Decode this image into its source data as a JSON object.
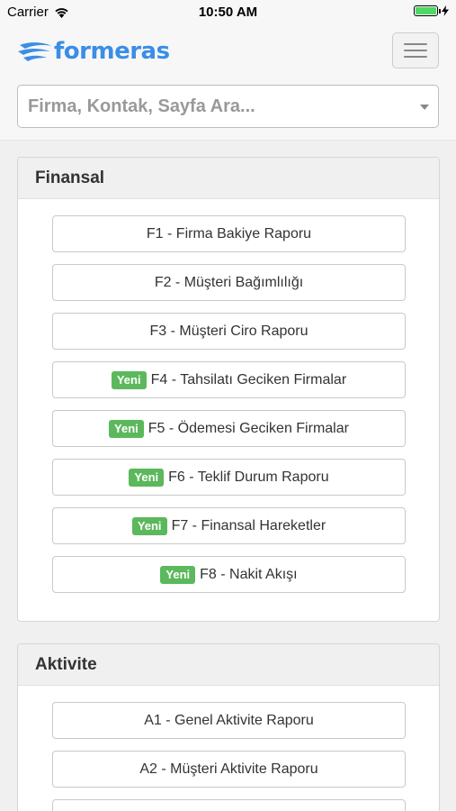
{
  "status_bar": {
    "carrier": "Carrier",
    "time": "10:50 AM"
  },
  "header": {
    "logo": "formeras",
    "search_placeholder": "Firma, Kontak, Sayfa Ara..."
  },
  "badge_new": "Yeni",
  "sections": [
    {
      "title": "Finansal",
      "items": [
        {
          "label": "F1 - Firma Bakiye Raporu",
          "new": false
        },
        {
          "label": "F2 - Müşteri Bağımlılığı",
          "new": false
        },
        {
          "label": "F3 - Müşteri Ciro Raporu",
          "new": false
        },
        {
          "label": "F4 - Tahsilatı Geciken Firmalar",
          "new": true
        },
        {
          "label": "F5 - Ödemesi Geciken Firmalar",
          "new": true
        },
        {
          "label": "F6 - Teklif Durum Raporu",
          "new": true
        },
        {
          "label": "F7 - Finansal Hareketler",
          "new": true
        },
        {
          "label": "F8 - Nakit Akışı",
          "new": true
        }
      ]
    },
    {
      "title": "Aktivite",
      "items": [
        {
          "label": "A1 - Genel Aktivite Raporu",
          "new": false
        },
        {
          "label": "A2 - Müşteri Aktivite Raporu",
          "new": false
        },
        {
          "label": "",
          "new": false
        }
      ]
    }
  ]
}
